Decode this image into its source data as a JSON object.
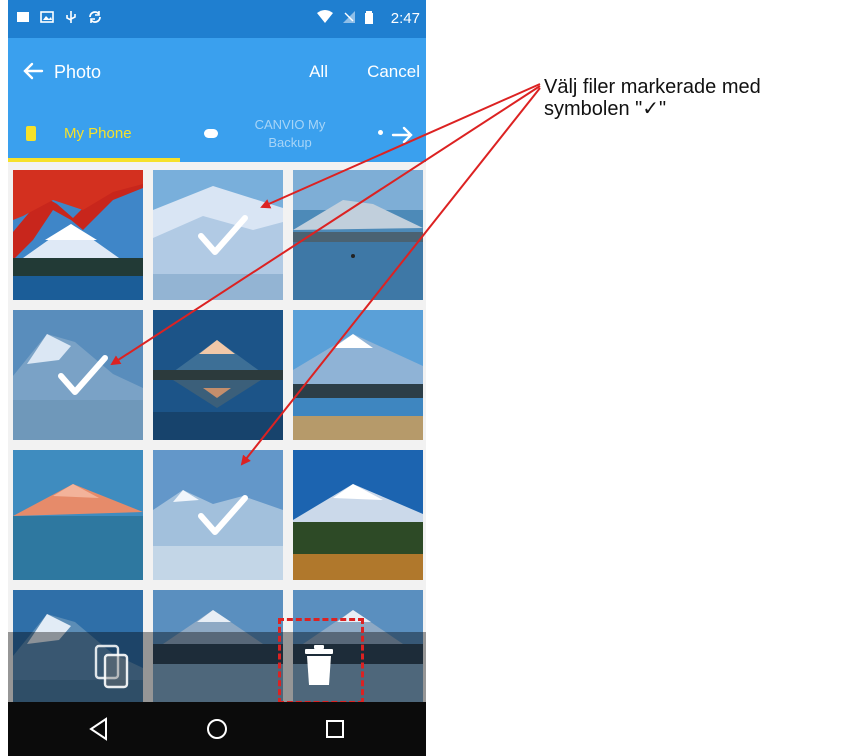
{
  "status_bar": {
    "time": "2:47"
  },
  "app_bar": {
    "title": "Photo",
    "all_label": "All",
    "cancel_label": "Cancel"
  },
  "tabs": {
    "my_phone": "My Phone",
    "canvio_line1": "CANVIO My",
    "canvio_line2": "Backup"
  },
  "annotation": {
    "line1": "Välj filer markerade med",
    "line2": "symbolen \"✓\""
  },
  "colors": {
    "status_bar": "#1f7fd0",
    "app_bar": "#3aa0ee",
    "tab_indicator": "#f6e12a",
    "arrow": "#dc2222",
    "nav_bar": "#0b0b0b"
  },
  "icons": {
    "status": [
      "notification-icon",
      "image-icon",
      "usb-icon",
      "sync-icon",
      "wifi-icon",
      "signal-icon",
      "battery-icon"
    ],
    "app_bar": [
      "back-arrow-icon"
    ],
    "tabs": [
      "phone-icon",
      "drive-icon",
      "forward-arrow-icon"
    ],
    "actions": [
      "copy-icon",
      "trash-icon"
    ],
    "nav": [
      "back-nav-icon",
      "home-nav-icon",
      "recents-nav-icon"
    ]
  },
  "photos": [
    {
      "name": "photo-1",
      "scene": "red-maple",
      "selected": false
    },
    {
      "name": "photo-2",
      "scene": "snow-peak",
      "selected": true
    },
    {
      "name": "photo-3",
      "scene": "misty-lake",
      "selected": false
    },
    {
      "name": "photo-4",
      "scene": "blue-peak",
      "selected": true
    },
    {
      "name": "photo-5",
      "scene": "sunset-reflection",
      "selected": false
    },
    {
      "name": "photo-6",
      "scene": "reeds-lake",
      "selected": false
    },
    {
      "name": "photo-7",
      "scene": "pink-peak",
      "selected": false
    },
    {
      "name": "photo-8",
      "scene": "snow-peak-lake",
      "selected": true
    },
    {
      "name": "photo-9",
      "scene": "forest-peak",
      "selected": false
    },
    {
      "name": "photo-10",
      "scene": "blue-peak",
      "selected": false
    },
    {
      "name": "photo-11",
      "scene": "lake-peak",
      "selected": false
    },
    {
      "name": "photo-12",
      "scene": "lake-peak",
      "selected": false
    }
  ]
}
